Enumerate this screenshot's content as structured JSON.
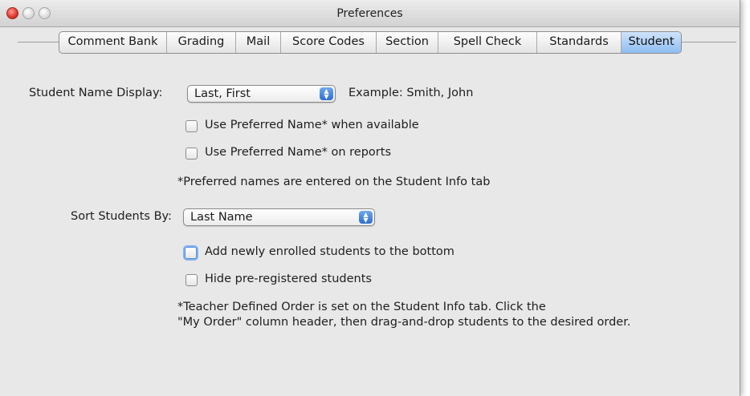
{
  "window": {
    "title": "Preferences"
  },
  "tabs": [
    {
      "label": "Comment Bank",
      "active": false
    },
    {
      "label": "Grading",
      "active": false
    },
    {
      "label": "Mail",
      "active": false
    },
    {
      "label": "Score Codes",
      "active": false
    },
    {
      "label": "Section",
      "active": false
    },
    {
      "label": "Spell Check",
      "active": false
    },
    {
      "label": "Standards",
      "active": false
    },
    {
      "label": "Student",
      "active": true
    }
  ],
  "student": {
    "name_display_label": "Student Name Display:",
    "name_display_value": "Last, First",
    "example_text": "Example: Smith, John",
    "use_preferred_available_label": "Use Preferred Name* when available",
    "use_preferred_available_checked": false,
    "use_preferred_reports_label": "Use Preferred Name* on reports",
    "use_preferred_reports_checked": false,
    "preferred_note": "*Preferred names are entered on the Student Info tab",
    "sort_label": "Sort Students By:",
    "sort_value": "Last Name",
    "add_bottom_label": "Add newly enrolled students to the bottom",
    "add_bottom_checked": false,
    "hide_prereg_label": "Hide pre-registered students",
    "hide_prereg_checked": false,
    "order_note_line1": "*Teacher Defined Order is set on the Student Info tab.  Click the",
    "order_note_line2": "\"My Order\" column header, then drag-and-drop students to the desired order."
  },
  "colors": {
    "active_tab": "#8ebdf2",
    "close_button": "#e0342a",
    "focus_ring": "#7fb2ef"
  }
}
